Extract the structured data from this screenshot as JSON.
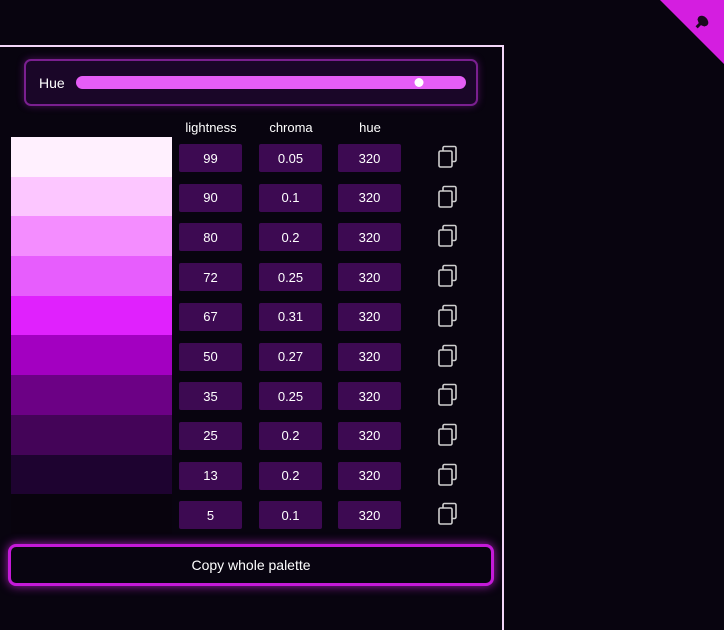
{
  "hue_control": {
    "label": "Hue",
    "value_fraction": 0.88
  },
  "columns": {
    "lightness": "lightness",
    "chroma": "chroma",
    "hue": "hue"
  },
  "palette": [
    {
      "lightness": "99",
      "chroma": "0.05",
      "hue": "320",
      "color": "#fff0fe"
    },
    {
      "lightness": "90",
      "chroma": "0.1",
      "hue": "320",
      "color": "#fcc6ff"
    },
    {
      "lightness": "80",
      "chroma": "0.2",
      "hue": "320",
      "color": "#f48dff"
    },
    {
      "lightness": "72",
      "chroma": "0.25",
      "hue": "320",
      "color": "#e75dfd"
    },
    {
      "lightness": "67",
      "chroma": "0.31",
      "hue": "320",
      "color": "#e021fd"
    },
    {
      "lightness": "50",
      "chroma": "0.27",
      "hue": "320",
      "color": "#a300c1"
    },
    {
      "lightness": "35",
      "chroma": "0.25",
      "hue": "320",
      "color": "#6c0185"
    },
    {
      "lightness": "25",
      "chroma": "0.2",
      "hue": "320",
      "color": "#440458"
    },
    {
      "lightness": "13",
      "chroma": "0.2",
      "hue": "320",
      "color": "#1e0330"
    },
    {
      "lightness": "5",
      "chroma": "0.1",
      "hue": "320",
      "color": "#08030d"
    }
  ],
  "copy_all_button": {
    "label": "Copy whole palette"
  },
  "colors": {
    "background": "#08040f",
    "accent": "#c41ad8",
    "value_box": "#3d0a52",
    "slider_track": "#e55df6"
  },
  "icons": {
    "copy": "copy-icon",
    "corner": "corner-ribbon-icon"
  }
}
